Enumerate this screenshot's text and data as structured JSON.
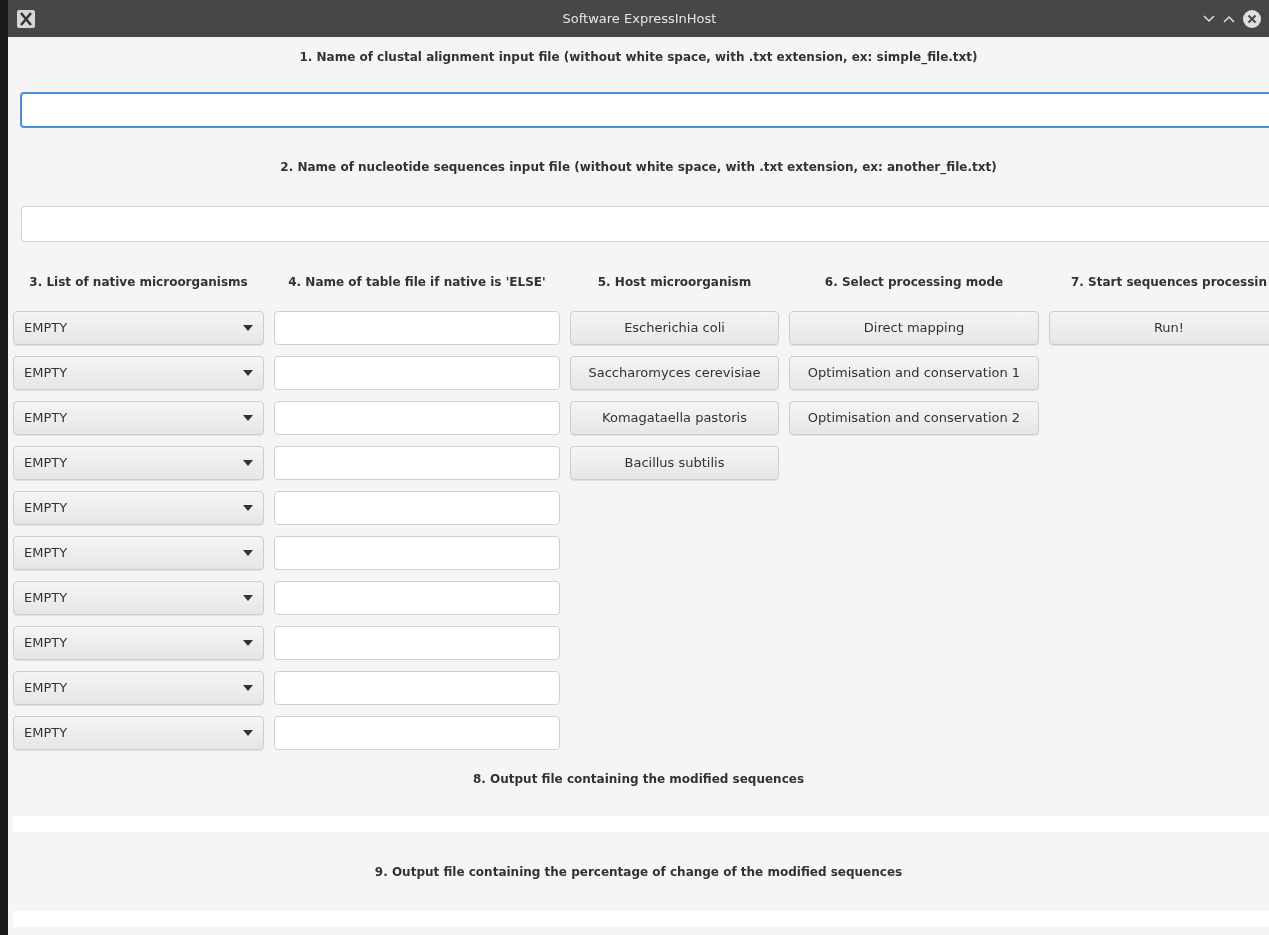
{
  "window": {
    "title": "Software ExpressInHost"
  },
  "alignment_file": {
    "label": "1. Name of clustal alignment input file (without white space, with .txt extension, ex: simple_file.txt)",
    "focused": true
  },
  "nucleotide_file": {
    "label": "2. Name of nucleotide sequences input file (without white space, with .txt extension, ex: another_file.txt)",
    "focused": false
  },
  "columns": [
    "3. List of native microorganisms",
    "4. Name of table file if native is 'ELSE'",
    "5. Host microorganism",
    "6. Select processing mode",
    "7. Start sequences processin"
  ],
  "native_rows": [
    {
      "value": "EMPTY"
    },
    {
      "value": "EMPTY"
    },
    {
      "value": "EMPTY"
    },
    {
      "value": "EMPTY"
    },
    {
      "value": "EMPTY"
    },
    {
      "value": "EMPTY"
    },
    {
      "value": "EMPTY"
    },
    {
      "value": "EMPTY"
    },
    {
      "value": "EMPTY"
    },
    {
      "value": "EMPTY"
    }
  ],
  "hosts": [
    "Escherichia coli",
    "Saccharomyces cerevisiae",
    "Komagataella pastoris",
    "Bacillus subtilis"
  ],
  "modes": [
    "Direct mapping",
    "Optimisation and conservation 1",
    "Optimisation and conservation 2"
  ],
  "run_button": "Run!",
  "outputs": [
    "8. Output file containing the modified sequences",
    "9. Output file containing the percentage of change of the modified sequences"
  ]
}
